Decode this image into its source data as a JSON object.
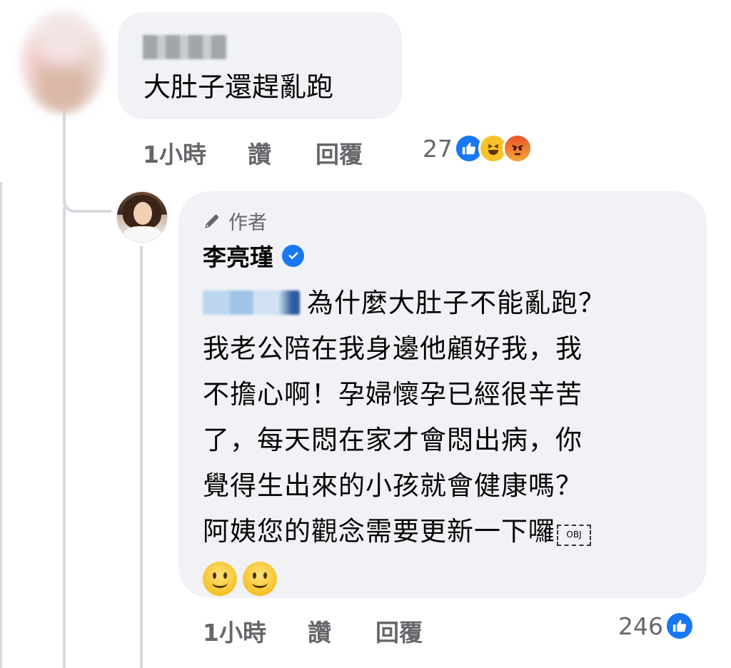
{
  "comment1": {
    "text": "大肚子還趕亂跑",
    "time": "1小時",
    "like_label": "讚",
    "reply_label": "回覆",
    "reaction_count": "27",
    "reactions": [
      "like-icon",
      "haha-icon",
      "angry-icon"
    ]
  },
  "reply": {
    "author_tag": "作者",
    "author_name": "李亮瑾",
    "verified": true,
    "body_lines": [
      "為什麼大肚子不能亂跑？",
      "我老公陪在我身邊他顧好我，我",
      "不擔心啊！孕婦懷孕已經很辛苦",
      "了，每天悶在家才會悶出病，你",
      "覺得生出來的小孩就會健康嗎？",
      "阿姨您的觀念需要更新一下囉"
    ],
    "obj_marker": "OBJ",
    "emojis": [
      "smiley-icon",
      "smiley-icon"
    ],
    "time": "1小時",
    "like_label": "讚",
    "reply_label": "回覆",
    "reaction_count": "246",
    "reactions": [
      "like-icon"
    ]
  },
  "colors": {
    "bubble": "#f0f2f5",
    "secondary_text": "#65676b",
    "facebook_blue": "#1877f2",
    "thread_line": "#d6d9de"
  }
}
